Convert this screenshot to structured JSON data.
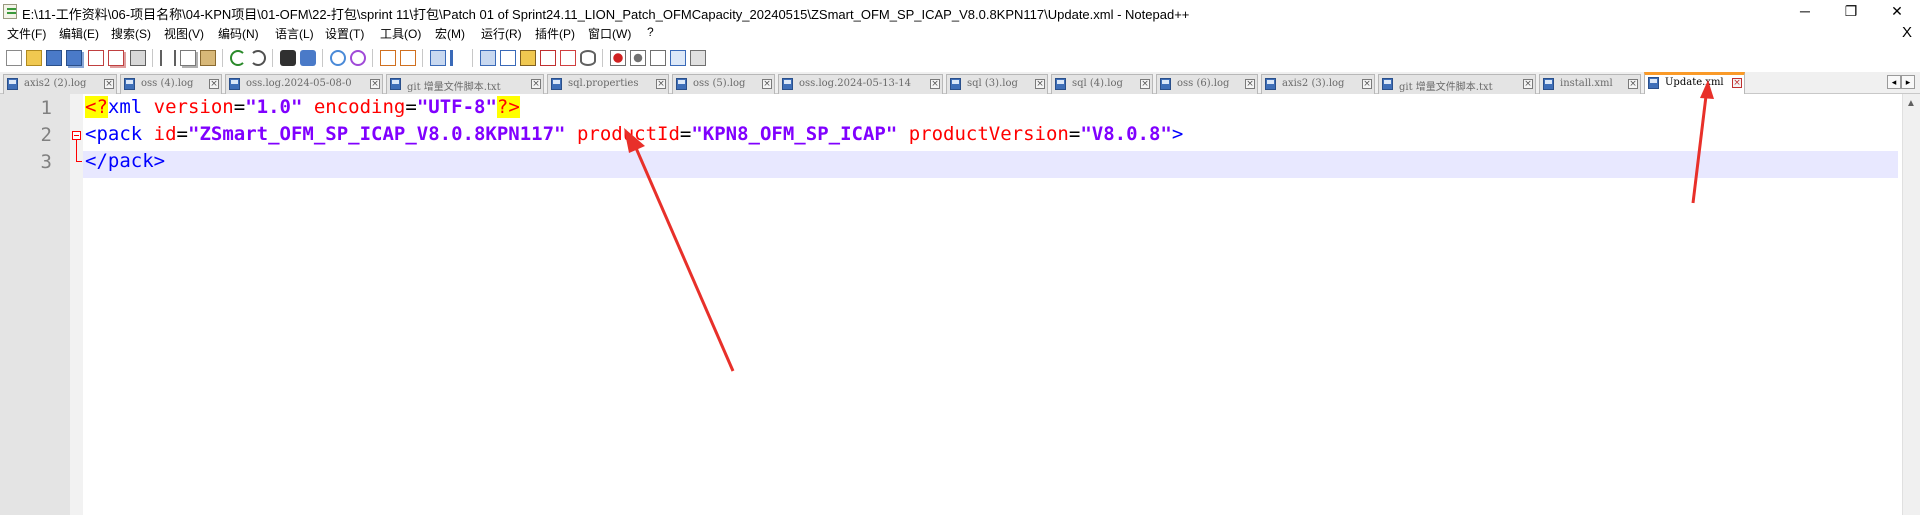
{
  "window": {
    "title": "E:\\11-工作资料\\06-项目名称\\04-KPN项目\\01-OFM\\22-打包\\sprint 11\\打包\\Patch 01 of Sprint24.11_LION_Patch_OFMCapacity_20240515\\ZSmart_OFM_SP_ICAP_V8.0.8KPN117\\Update.xml - Notepad++",
    "minimize": "─",
    "restore": "❐",
    "close": "✕"
  },
  "menu": {
    "items": [
      "文件(F)",
      "编辑(E)",
      "搜索(S)",
      "视图(V)",
      "编码(N)",
      "语言(L)",
      "设置(T)",
      "工具(O)",
      "宏(M)",
      "运行(R)",
      "插件(P)",
      "窗口(W)",
      "?"
    ],
    "close_doc": "X"
  },
  "toolbar": {
    "icons": [
      "new-file-icon",
      "open-file-icon",
      "save-icon",
      "save-all-icon",
      "close-icon",
      "close-all-icon",
      "print-icon",
      "cut-icon",
      "copy-icon",
      "paste-icon",
      "undo-icon",
      "redo-icon",
      "find-icon",
      "replace-icon",
      "zoom-in-icon",
      "zoom-out-icon",
      "sync-vertical-icon",
      "sync-horizontal-icon",
      "word-wrap-icon",
      "show-all-chars-icon",
      "indent-guide-icon",
      "function-list-icon",
      "folder-workspace-icon",
      "doc-map-icon",
      "document-list-icon",
      "monitoring-icon",
      "macro-record-icon",
      "macro-stop-icon",
      "macro-play-icon",
      "macro-run-multiple-icon",
      "macro-save-icon"
    ]
  },
  "tabs": [
    {
      "label": "axis2 (2).log",
      "active": false
    },
    {
      "label": "oss (4).log",
      "active": false
    },
    {
      "label": "oss.log.2024-05-08-0",
      "active": false
    },
    {
      "label": "git 增量文件脚本.txt",
      "active": false
    },
    {
      "label": "sql.properties",
      "active": false
    },
    {
      "label": "oss (5).log",
      "active": false
    },
    {
      "label": "oss.log.2024-05-13-14",
      "active": false
    },
    {
      "label": "sql (3).log",
      "active": false
    },
    {
      "label": "sql (4).log",
      "active": false
    },
    {
      "label": "oss (6).log",
      "active": false
    },
    {
      "label": "axis2 (3).log",
      "active": false
    },
    {
      "label": "git 增量文件脚本.txt",
      "active": false
    },
    {
      "label": "install.xml",
      "active": false
    },
    {
      "label": "Update.xml",
      "active": true
    }
  ],
  "tab_nav": {
    "prev": "◂",
    "next": "▸"
  },
  "editor": {
    "line_numbers": [
      "1",
      "2",
      "3"
    ],
    "line1": {
      "pi_open": "<?",
      "tag": "xml",
      "attr1": "version",
      "val1": "\"1.0\"",
      "attr2": "encoding",
      "val2": "\"UTF-8\"",
      "pi_close": "?>"
    },
    "line2": {
      "open": "<pack",
      "attr1": "id",
      "val1": "\"ZSmart_OFM_SP_ICAP_V8.0.8KPN117\"",
      "attr2": "productId",
      "val2": "\"KPN8_OFM_SP_ICAP\"",
      "attr3": "productVersion",
      "val3": "\"V8.0.8\"",
      "close": ">"
    },
    "line3": {
      "close_tag": "</pack>"
    },
    "equals": "="
  },
  "colors": {
    "annotation_arrow": "#e8302a",
    "active_tab_accent": "#fa9a28",
    "xml_tag": "#0000ff",
    "xml_attr": "#ff0000",
    "xml_value": "#8000ff",
    "current_line": "#e8e8ff"
  }
}
